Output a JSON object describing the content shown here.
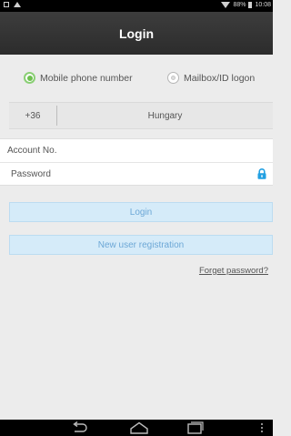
{
  "status_bar": {
    "battery_percent": "88%",
    "time": "10:08",
    "icons": [
      "notification-icon",
      "alert-icon",
      "wifi-icon",
      "battery-icon"
    ]
  },
  "header": {
    "title": "Login"
  },
  "login_mode": {
    "options": [
      {
        "label": "Mobile phone number",
        "selected": true
      },
      {
        "label": "Mailbox/ID logon",
        "selected": false
      }
    ],
    "accent_color": "#6dc04f"
  },
  "country": {
    "code": "+36",
    "name": "Hungary"
  },
  "form": {
    "account_placeholder": "Account No.",
    "account_value": "",
    "password_placeholder": "Password",
    "password_value": "",
    "lock_icon": "lock-icon",
    "lock_color": "#22a0e2"
  },
  "buttons": {
    "login_label": "Login",
    "register_label": "New user registration",
    "button_color": "#d5ebf9"
  },
  "links": {
    "forget_password": "Forget password?"
  },
  "nav_bar": {
    "icons": [
      "back-icon",
      "home-icon",
      "recent-apps-icon",
      "menu-icon"
    ]
  }
}
